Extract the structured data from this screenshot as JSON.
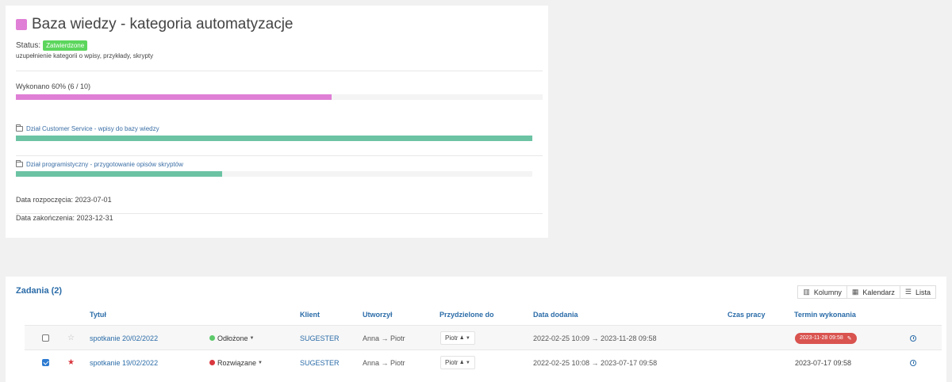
{
  "project": {
    "title": "Baza wiedzy - kategoria automatyzacje",
    "color": "#e07fd6",
    "status_label": "Status:",
    "status_badge": "Zatwierdzone",
    "description": "uzupełnienie kategorii o wpisy, przykłady, skrypty",
    "progress_label": "Wykonano 60% (6 / 10)",
    "progress": 0.6,
    "subprojects": [
      {
        "label": "Dział Customer Service - wpisy do bazy wiedzy",
        "progress": 1.0
      },
      {
        "label": "Dział programistyczny - przygotowanie opisów skryptów",
        "progress": 0.4
      }
    ],
    "start_date": "Data rozpoczęcia: 2023-07-01",
    "end_date": "Data zakończenia: 2023-12-31"
  },
  "tasks": {
    "title": "Zadania (2)",
    "views": [
      {
        "label": "Kolumny",
        "icon": "columns-icon"
      },
      {
        "label": "Kalendarz",
        "icon": "calendar-icon"
      },
      {
        "label": "Lista",
        "icon": "list-icon"
      }
    ],
    "columns": [
      "Tytuł",
      "Klient",
      "Utworzył",
      "Przydzielone do",
      "Data dodania",
      "Czas pracy",
      "Termin wykonania"
    ],
    "rows": [
      {
        "checked": false,
        "starred": false,
        "title": "spotkanie 20/02/2022",
        "status": "Odłożone",
        "status_color": "#5cc96a",
        "client": "SUGESTER",
        "created_by": "Anna → Piotr",
        "assigned": "Piotr",
        "dates": "2022-02-25 10:09 → 2023-11-28 09:58",
        "deadline": "2023-11-28 09:58"
      },
      {
        "checked": true,
        "starred": true,
        "title": "spotkanie 19/02/2022",
        "status": "Rozwiązane",
        "status_color": "#d9363e",
        "client": "SUGESTER",
        "created_by": "Anna → Piotr",
        "assigned": "Piotr",
        "dates": "2022-02-25 10:08 → 2023-07-17 09:58",
        "deadline": "2023-07-17 09:58"
      }
    ]
  }
}
